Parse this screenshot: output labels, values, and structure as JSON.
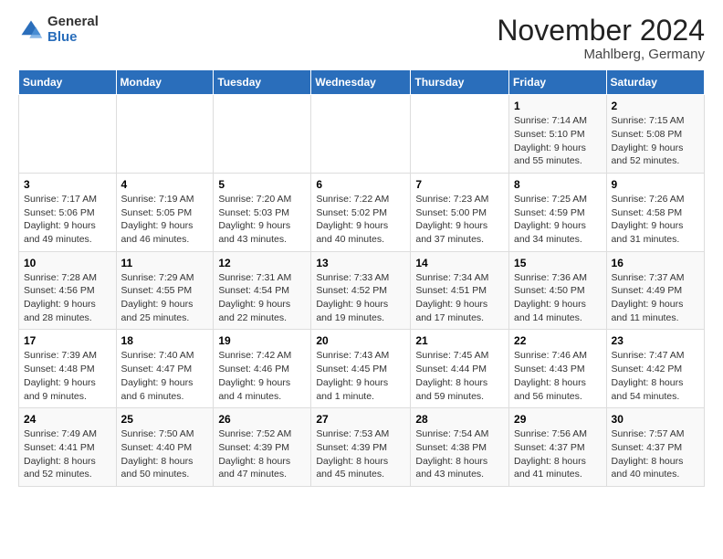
{
  "logo": {
    "general": "General",
    "blue": "Blue"
  },
  "title": "November 2024",
  "subtitle": "Mahlberg, Germany",
  "days_header": [
    "Sunday",
    "Monday",
    "Tuesday",
    "Wednesday",
    "Thursday",
    "Friday",
    "Saturday"
  ],
  "weeks": [
    [
      {
        "day": "",
        "detail": ""
      },
      {
        "day": "",
        "detail": ""
      },
      {
        "day": "",
        "detail": ""
      },
      {
        "day": "",
        "detail": ""
      },
      {
        "day": "",
        "detail": ""
      },
      {
        "day": "1",
        "detail": "Sunrise: 7:14 AM\nSunset: 5:10 PM\nDaylight: 9 hours and 55 minutes."
      },
      {
        "day": "2",
        "detail": "Sunrise: 7:15 AM\nSunset: 5:08 PM\nDaylight: 9 hours and 52 minutes."
      }
    ],
    [
      {
        "day": "3",
        "detail": "Sunrise: 7:17 AM\nSunset: 5:06 PM\nDaylight: 9 hours and 49 minutes."
      },
      {
        "day": "4",
        "detail": "Sunrise: 7:19 AM\nSunset: 5:05 PM\nDaylight: 9 hours and 46 minutes."
      },
      {
        "day": "5",
        "detail": "Sunrise: 7:20 AM\nSunset: 5:03 PM\nDaylight: 9 hours and 43 minutes."
      },
      {
        "day": "6",
        "detail": "Sunrise: 7:22 AM\nSunset: 5:02 PM\nDaylight: 9 hours and 40 minutes."
      },
      {
        "day": "7",
        "detail": "Sunrise: 7:23 AM\nSunset: 5:00 PM\nDaylight: 9 hours and 37 minutes."
      },
      {
        "day": "8",
        "detail": "Sunrise: 7:25 AM\nSunset: 4:59 PM\nDaylight: 9 hours and 34 minutes."
      },
      {
        "day": "9",
        "detail": "Sunrise: 7:26 AM\nSunset: 4:58 PM\nDaylight: 9 hours and 31 minutes."
      }
    ],
    [
      {
        "day": "10",
        "detail": "Sunrise: 7:28 AM\nSunset: 4:56 PM\nDaylight: 9 hours and 28 minutes."
      },
      {
        "day": "11",
        "detail": "Sunrise: 7:29 AM\nSunset: 4:55 PM\nDaylight: 9 hours and 25 minutes."
      },
      {
        "day": "12",
        "detail": "Sunrise: 7:31 AM\nSunset: 4:54 PM\nDaylight: 9 hours and 22 minutes."
      },
      {
        "day": "13",
        "detail": "Sunrise: 7:33 AM\nSunset: 4:52 PM\nDaylight: 9 hours and 19 minutes."
      },
      {
        "day": "14",
        "detail": "Sunrise: 7:34 AM\nSunset: 4:51 PM\nDaylight: 9 hours and 17 minutes."
      },
      {
        "day": "15",
        "detail": "Sunrise: 7:36 AM\nSunset: 4:50 PM\nDaylight: 9 hours and 14 minutes."
      },
      {
        "day": "16",
        "detail": "Sunrise: 7:37 AM\nSunset: 4:49 PM\nDaylight: 9 hours and 11 minutes."
      }
    ],
    [
      {
        "day": "17",
        "detail": "Sunrise: 7:39 AM\nSunset: 4:48 PM\nDaylight: 9 hours and 9 minutes."
      },
      {
        "day": "18",
        "detail": "Sunrise: 7:40 AM\nSunset: 4:47 PM\nDaylight: 9 hours and 6 minutes."
      },
      {
        "day": "19",
        "detail": "Sunrise: 7:42 AM\nSunset: 4:46 PM\nDaylight: 9 hours and 4 minutes."
      },
      {
        "day": "20",
        "detail": "Sunrise: 7:43 AM\nSunset: 4:45 PM\nDaylight: 9 hours and 1 minute."
      },
      {
        "day": "21",
        "detail": "Sunrise: 7:45 AM\nSunset: 4:44 PM\nDaylight: 8 hours and 59 minutes."
      },
      {
        "day": "22",
        "detail": "Sunrise: 7:46 AM\nSunset: 4:43 PM\nDaylight: 8 hours and 56 minutes."
      },
      {
        "day": "23",
        "detail": "Sunrise: 7:47 AM\nSunset: 4:42 PM\nDaylight: 8 hours and 54 minutes."
      }
    ],
    [
      {
        "day": "24",
        "detail": "Sunrise: 7:49 AM\nSunset: 4:41 PM\nDaylight: 8 hours and 52 minutes."
      },
      {
        "day": "25",
        "detail": "Sunrise: 7:50 AM\nSunset: 4:40 PM\nDaylight: 8 hours and 50 minutes."
      },
      {
        "day": "26",
        "detail": "Sunrise: 7:52 AM\nSunset: 4:39 PM\nDaylight: 8 hours and 47 minutes."
      },
      {
        "day": "27",
        "detail": "Sunrise: 7:53 AM\nSunset: 4:39 PM\nDaylight: 8 hours and 45 minutes."
      },
      {
        "day": "28",
        "detail": "Sunrise: 7:54 AM\nSunset: 4:38 PM\nDaylight: 8 hours and 43 minutes."
      },
      {
        "day": "29",
        "detail": "Sunrise: 7:56 AM\nSunset: 4:37 PM\nDaylight: 8 hours and 41 minutes."
      },
      {
        "day": "30",
        "detail": "Sunrise: 7:57 AM\nSunset: 4:37 PM\nDaylight: 8 hours and 40 minutes."
      }
    ]
  ]
}
